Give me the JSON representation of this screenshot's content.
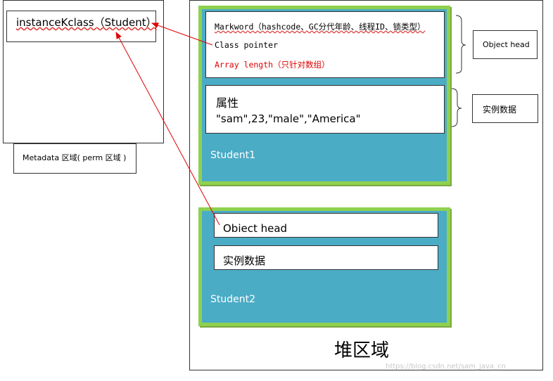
{
  "metadata_area": {
    "klass_label": "instanceKclass（Student）",
    "caption": "Metadata 区域( perm 区域 )"
  },
  "heap": {
    "label": "堆区域",
    "student1": {
      "name": "Student1",
      "header_lines": {
        "markword": "Markword（hashcode、GC分代年龄、线程ID、锁类型）",
        "class_pointer": "Class pointer",
        "array_length": "Array length（只针对数组）"
      },
      "fields_title": "属性",
      "fields_values": "\"sam\",23,\"male\",\"America\""
    },
    "student2": {
      "name": "Student2",
      "header": "Obiect head",
      "instance_data": "实例数据"
    }
  },
  "annotations": {
    "object_head": "Object head",
    "instance_data": "实例数据"
  },
  "colors": {
    "object_fill": "#4bacc6",
    "object_border": "#8fd14f",
    "arrow": "#e00000",
    "array_length_text": "#e00000"
  },
  "watermark": "https://blog.csdn.net/sam_java_cn"
}
